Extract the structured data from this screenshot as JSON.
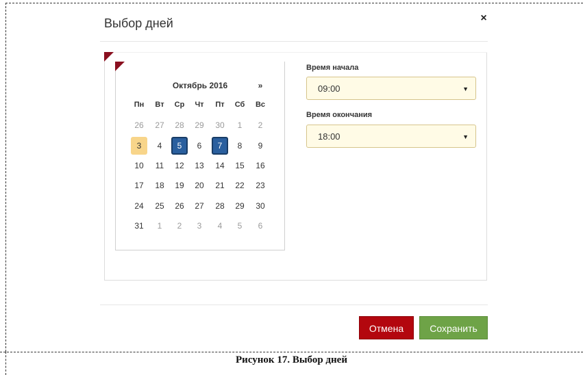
{
  "dialog": {
    "title": "Выбор дней",
    "close_icon": "×"
  },
  "calendar": {
    "month_title": "Октябрь 2016",
    "next_label": "»",
    "weekdays": [
      "Пн",
      "Вт",
      "Ср",
      "Чт",
      "Пт",
      "Сб",
      "Вс"
    ],
    "weeks": [
      [
        {
          "d": "26",
          "state": "muted"
        },
        {
          "d": "27",
          "state": "muted"
        },
        {
          "d": "28",
          "state": "muted"
        },
        {
          "d": "29",
          "state": "muted"
        },
        {
          "d": "30",
          "state": "muted"
        },
        {
          "d": "1",
          "state": "muted"
        },
        {
          "d": "2",
          "state": "muted"
        }
      ],
      [
        {
          "d": "3",
          "state": "today"
        },
        {
          "d": "4",
          "state": "normal"
        },
        {
          "d": "5",
          "state": "selected"
        },
        {
          "d": "6",
          "state": "normal"
        },
        {
          "d": "7",
          "state": "selected"
        },
        {
          "d": "8",
          "state": "normal"
        },
        {
          "d": "9",
          "state": "normal"
        }
      ],
      [
        {
          "d": "10",
          "state": "normal"
        },
        {
          "d": "11",
          "state": "normal"
        },
        {
          "d": "12",
          "state": "normal"
        },
        {
          "d": "13",
          "state": "normal"
        },
        {
          "d": "14",
          "state": "normal"
        },
        {
          "d": "15",
          "state": "normal"
        },
        {
          "d": "16",
          "state": "normal"
        }
      ],
      [
        {
          "d": "17",
          "state": "normal"
        },
        {
          "d": "18",
          "state": "normal"
        },
        {
          "d": "19",
          "state": "normal"
        },
        {
          "d": "20",
          "state": "normal"
        },
        {
          "d": "21",
          "state": "normal"
        },
        {
          "d": "22",
          "state": "normal"
        },
        {
          "d": "23",
          "state": "normal"
        }
      ],
      [
        {
          "d": "24",
          "state": "normal"
        },
        {
          "d": "25",
          "state": "normal"
        },
        {
          "d": "26",
          "state": "normal"
        },
        {
          "d": "27",
          "state": "normal"
        },
        {
          "d": "28",
          "state": "normal"
        },
        {
          "d": "29",
          "state": "normal"
        },
        {
          "d": "30",
          "state": "normal"
        }
      ],
      [
        {
          "d": "31",
          "state": "normal"
        },
        {
          "d": "1",
          "state": "muted"
        },
        {
          "d": "2",
          "state": "muted"
        },
        {
          "d": "3",
          "state": "muted"
        },
        {
          "d": "4",
          "state": "muted"
        },
        {
          "d": "5",
          "state": "muted"
        },
        {
          "d": "6",
          "state": "muted"
        }
      ]
    ]
  },
  "time": {
    "start_label": "Время начала",
    "start_value": "09:00",
    "end_label": "Время окончания",
    "end_value": "18:00",
    "caret": "▼"
  },
  "buttons": {
    "cancel": "Отмена",
    "save": "Сохранить"
  },
  "colors": {
    "cancel_bg": "#b3070e",
    "save_bg": "#6ea347",
    "selected_day": "#2a5f9e",
    "today_day": "#f8d58a",
    "flag": "#8a1020"
  },
  "caption": "Рисунок 17. Выбор дней"
}
